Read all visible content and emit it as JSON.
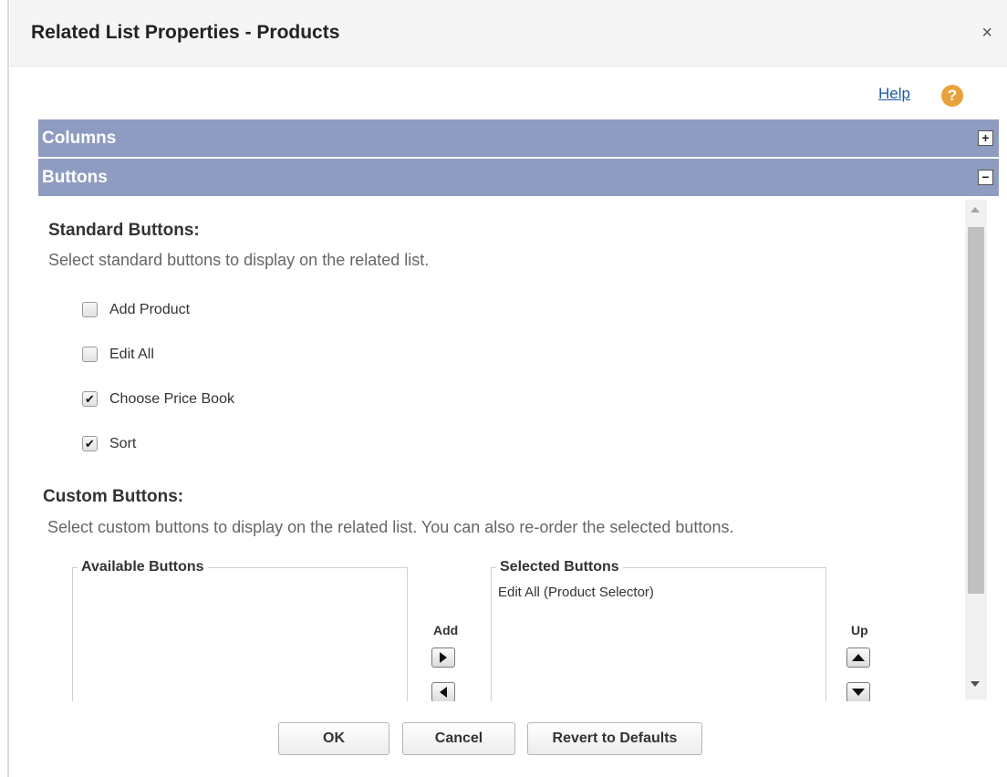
{
  "dialog": {
    "title": "Related List Properties - Products",
    "close_glyph": "×"
  },
  "help": {
    "link_label": "Help",
    "icon_glyph": "?",
    "icon_color": "#e9a23b"
  },
  "sections": {
    "columns": {
      "label": "Columns",
      "toggle": "+"
    },
    "buttons": {
      "label": "Buttons",
      "toggle": "−"
    },
    "bar_color": "#8e9cc1"
  },
  "standard_buttons": {
    "heading": "Standard Buttons:",
    "description": "Select standard buttons to display on the related list.",
    "items": [
      {
        "label": "Add Product",
        "checked": false,
        "mark": ""
      },
      {
        "label": "Edit All",
        "checked": false,
        "mark": ""
      },
      {
        "label": "Choose Price Book",
        "checked": true,
        "mark": "✔"
      },
      {
        "label": "Sort",
        "checked": true,
        "mark": "✔"
      }
    ]
  },
  "custom_buttons": {
    "heading": "Custom Buttons:",
    "description": "Select custom buttons to display on the related list. You can also re-order the selected buttons.",
    "available_legend": "Available Buttons",
    "selected_legend": "Selected Buttons",
    "selected_items": [
      "Edit All (Product Selector)"
    ],
    "add_label": "Add",
    "up_label": "Up"
  },
  "footer": {
    "ok_label": "OK",
    "cancel_label": "Cancel",
    "revert_label": "Revert to Defaults"
  }
}
